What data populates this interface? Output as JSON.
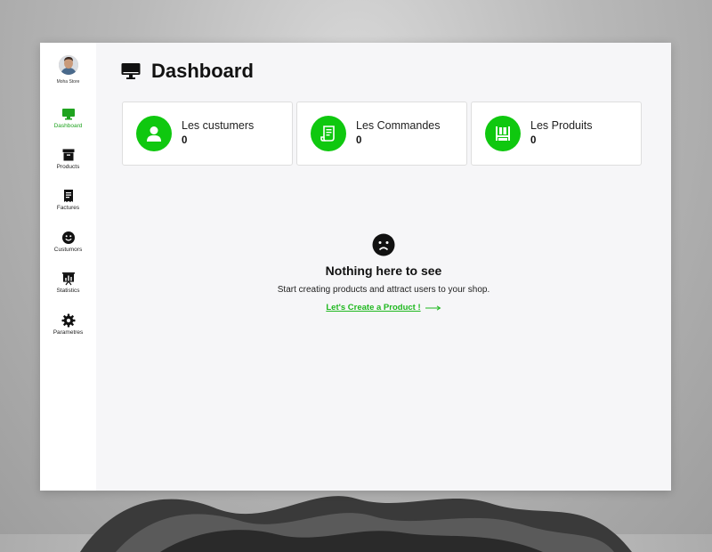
{
  "store": {
    "name": "Moha Store"
  },
  "sidebar": {
    "items": [
      {
        "label": "Dashboard",
        "icon": "monitor-icon",
        "active": true
      },
      {
        "label": "Products",
        "icon": "archive-box-icon"
      },
      {
        "label": "Factures",
        "icon": "receipt-icon"
      },
      {
        "label": "Custumors",
        "icon": "smiley-icon"
      },
      {
        "label": "Statistics",
        "icon": "presentation-chart-icon"
      },
      {
        "label": "Parametres",
        "icon": "gear-icon"
      }
    ]
  },
  "header": {
    "title": "Dashboard",
    "icon": "monitor-icon"
  },
  "cards": [
    {
      "label": "Les custumers",
      "value": "0",
      "icon": "user-icon"
    },
    {
      "label": "Les Commandes",
      "value": "0",
      "icon": "scroll-icon"
    },
    {
      "label": "Les Produits",
      "value": "0",
      "icon": "shelf-icon"
    }
  ],
  "empty_state": {
    "icon": "sad-face-icon",
    "title": "Nothing here to see",
    "description": "Start creating products and attract users to your shop.",
    "link_label": "Let's Create a Product !"
  },
  "colors": {
    "accent": "#0fc80f",
    "active_nav": "#1fa31f",
    "link": "#1fb81f",
    "panel_bg": "#f6f6f8"
  }
}
